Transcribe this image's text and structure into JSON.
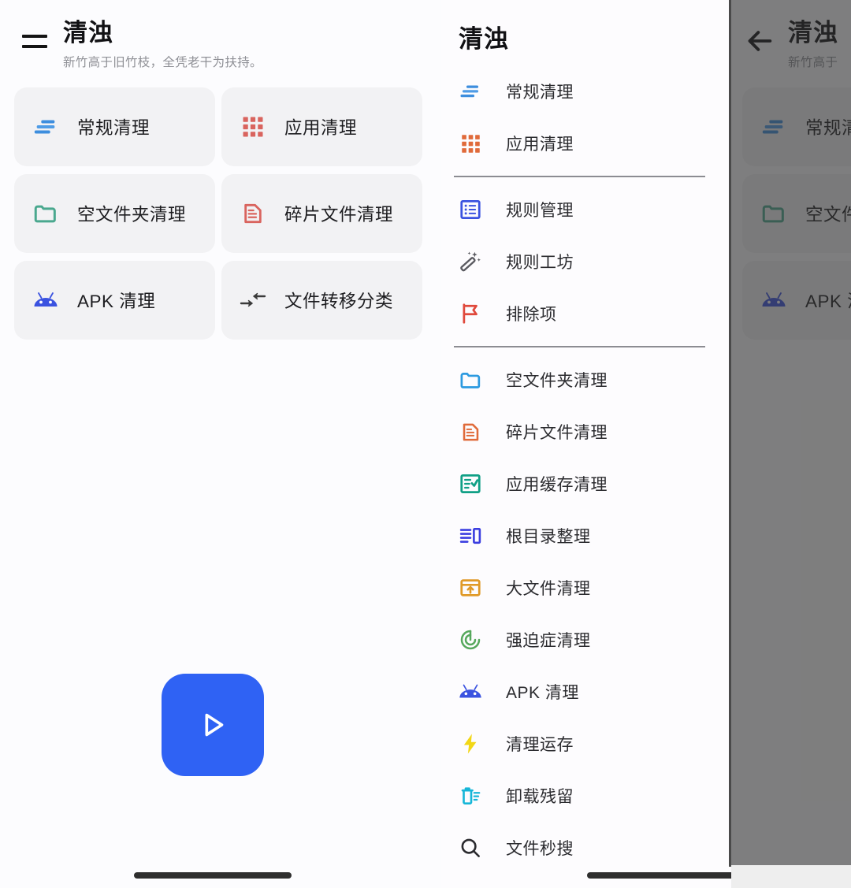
{
  "app": {
    "title": "清浊",
    "subtitle": "新竹高于旧竹枝，全凭老干为扶持。"
  },
  "home": {
    "menu_icon": "hamburger-menu-icon",
    "cards": [
      {
        "label": "常规清理",
        "icon": "lines-sort-icon",
        "color": "#3d8ede"
      },
      {
        "label": "应用清理",
        "icon": "grid-apps-icon",
        "color": "#d9645e"
      },
      {
        "label": "空文件夹清理",
        "icon": "folder-icon",
        "color": "#4aa88e"
      },
      {
        "label": "碎片文件清理",
        "icon": "document-icon",
        "color": "#d9645e"
      },
      {
        "label": "APK 清理",
        "icon": "android-icon",
        "color": "#3b53e0"
      },
      {
        "label": "文件转移分类",
        "icon": "transfer-arrows-icon",
        "color": "#3a3a3a"
      }
    ],
    "fab": {
      "icon": "play-triangle-icon",
      "color": "#2f62f4",
      "label": "运行"
    }
  },
  "drawer": {
    "title": "清浊",
    "groups": [
      {
        "items": [
          {
            "label": "常规清理",
            "icon": "lines-sort-icon",
            "color": "#3d8ede"
          },
          {
            "label": "应用清理",
            "icon": "grid-apps-icon",
            "color": "#e06a3a"
          }
        ]
      },
      {
        "items": [
          {
            "label": "规则管理",
            "icon": "list-box-icon",
            "color": "#3b53e0"
          },
          {
            "label": "规则工坊",
            "icon": "magic-wand-icon",
            "color": "#5a5a60"
          },
          {
            "label": "排除项",
            "icon": "flag-icon",
            "color": "#e0493c"
          }
        ]
      },
      {
        "items": [
          {
            "label": "空文件夹清理",
            "icon": "folder-icon",
            "color": "#2d9ae0"
          },
          {
            "label": "碎片文件清理",
            "icon": "document-icon",
            "color": "#e06a3a"
          },
          {
            "label": "应用缓存清理",
            "icon": "checklist-box-icon",
            "color": "#11a086"
          },
          {
            "label": "根目录整理",
            "icon": "list-panel-icon",
            "color": "#3b3ee0"
          },
          {
            "label": "大文件清理",
            "icon": "box-upload-icon",
            "color": "#e09a28"
          },
          {
            "label": "强迫症清理",
            "icon": "spiral-target-icon",
            "color": "#56a85c"
          },
          {
            "label": "APK 清理",
            "icon": "android-icon",
            "color": "#3b53e0"
          },
          {
            "label": "清理运存",
            "icon": "lightning-bolt-icon",
            "color": "#f2d716"
          },
          {
            "label": "卸载残留",
            "icon": "trash-lines-icon",
            "color": "#16b6d8"
          },
          {
            "label": "文件秒搜",
            "icon": "search-icon",
            "color": "#2b2b2f"
          }
        ]
      }
    ]
  },
  "scrim": {
    "back_icon": "back-arrow-icon",
    "title": "清浊",
    "subtitle": "新竹高于",
    "cards": [
      {
        "label": "常规清",
        "icon": "lines-sort-icon",
        "color": "#3d8ede"
      },
      {
        "label": "空文件",
        "icon": "folder-icon",
        "color": "#4aa88e"
      },
      {
        "label": "APK 清",
        "icon": "android-icon",
        "color": "#3b53e0"
      }
    ]
  }
}
